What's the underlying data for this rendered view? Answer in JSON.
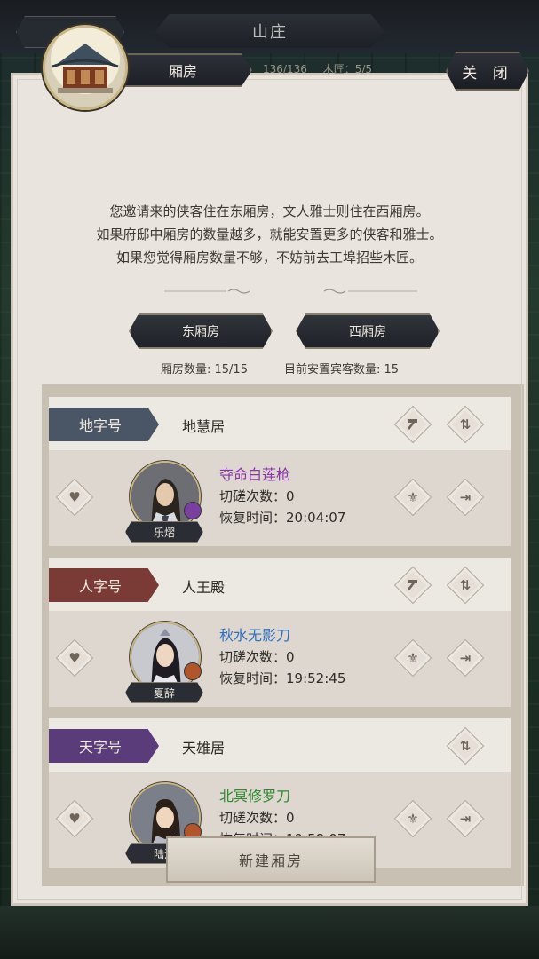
{
  "top_bar": {
    "title": "山庄"
  },
  "header": {
    "label": "厢房",
    "faded_counts": [
      "136/136",
      "木匠：5/5"
    ],
    "close": "关 闭"
  },
  "description": {
    "line1": "您邀请来的侠客住在东厢房，文人雅士则住在西厢房。",
    "line2": "如果府邸中厢房的数量越多，就能安置更多的侠客和雅士。",
    "line3": "如果您觉得厢房数量不够，不妨前去工埠招些木匠。"
  },
  "tabs": {
    "east": "东厢房",
    "west": "西厢房"
  },
  "stats": {
    "room_count": "厢房数量: 15/15",
    "guest_count": "目前安置宾客数量: 15"
  },
  "rooms": [
    {
      "tag": "地字号",
      "tag_color": "#4a5566",
      "name": "地慧居",
      "guest": {
        "title": "夺命白莲枪",
        "title_color": "#8a35a8",
        "duel_count": "切磋次数：0",
        "recovery": "恢复时间：20:04:07",
        "name": "乐熠"
      }
    },
    {
      "tag": "人字号",
      "tag_color": "#7a3a36",
      "name": "人王殿",
      "guest": {
        "title": "秋水无影刀",
        "title_color": "#2f6fbf",
        "duel_count": "切磋次数：0",
        "recovery": "恢复时间：19:52:45",
        "name": "夏辞"
      }
    },
    {
      "tag": "天字号",
      "tag_color": "#5a3c7a",
      "name": "天雄居",
      "guest": {
        "title": "北冥修罗刀",
        "title_color": "#2e8a2e",
        "duel_count": "切磋次数：0",
        "recovery": "恢复时间：19:58:07",
        "name": "陆沫"
      }
    }
  ],
  "new_room_button": "新建厢房",
  "icons": {
    "favorite": "heart-icon",
    "build": "hammer-icon",
    "swap": "swap-icon",
    "upgrade": "upgrade-icon",
    "exit": "exit-icon"
  }
}
